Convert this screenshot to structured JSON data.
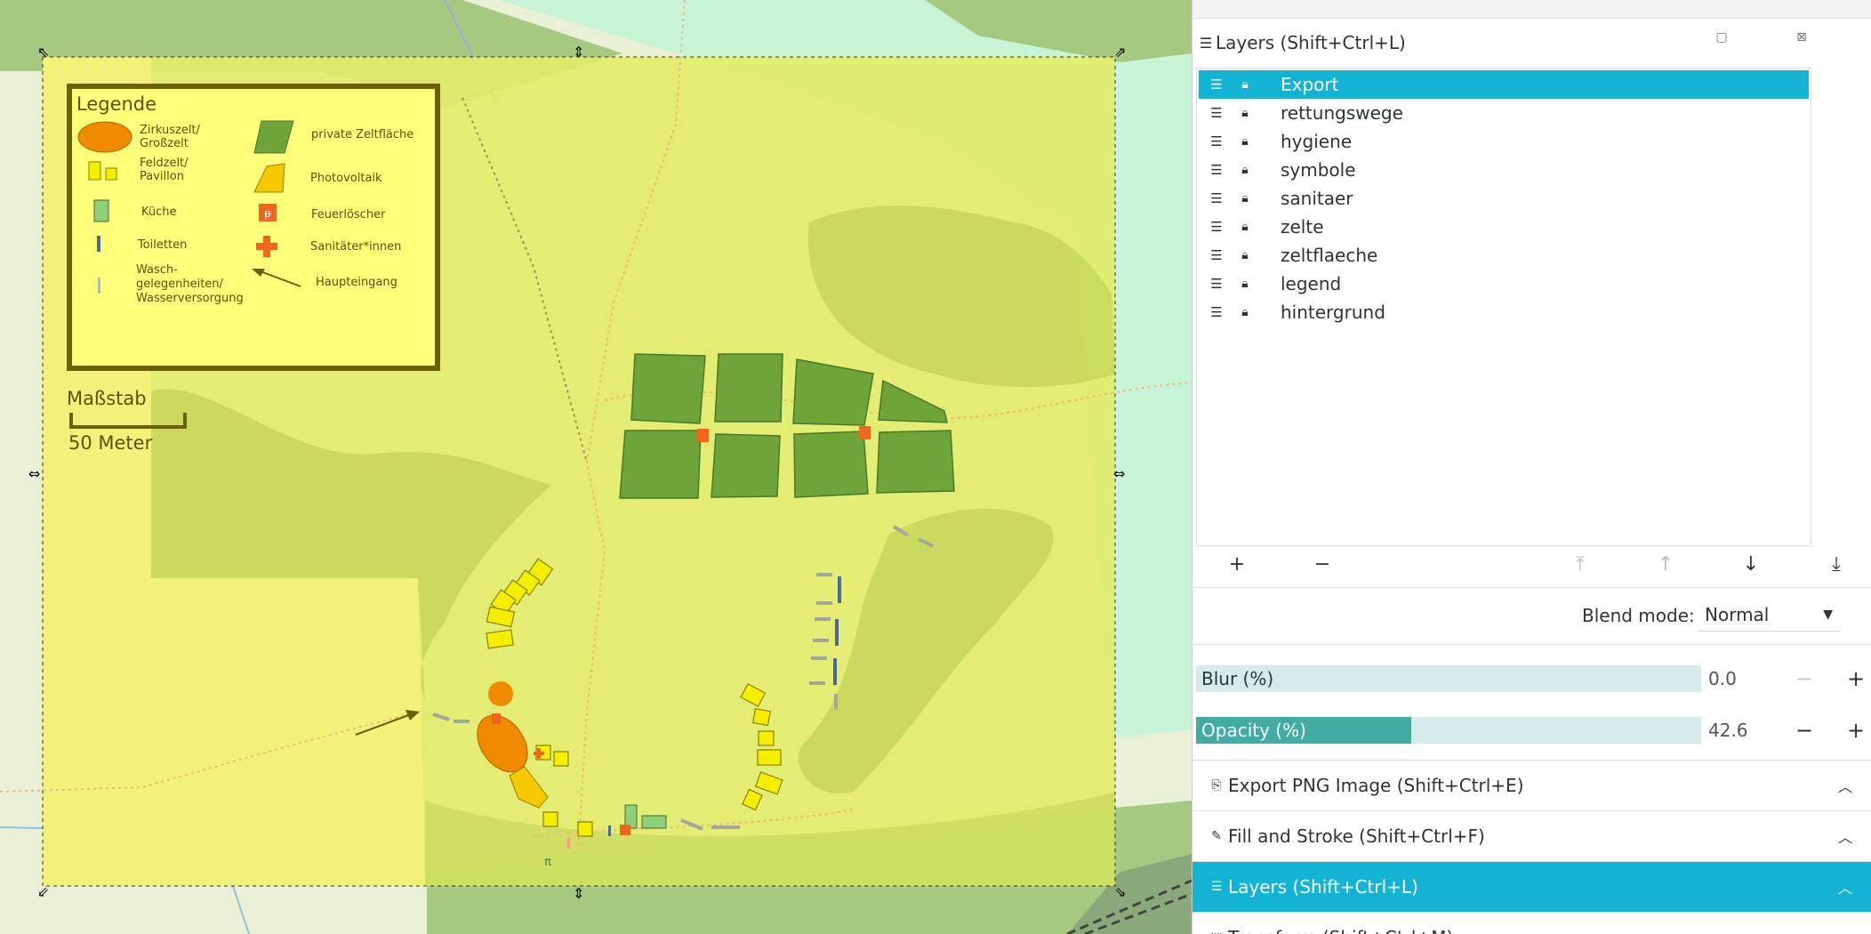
{
  "map": {
    "legend": {
      "title": "Legende",
      "items": {
        "zirkuszelt": "Zirkuszelt/\nGroßzelt",
        "feldzelt": "Feldzelt/\nPavillon",
        "kueche": "Küche",
        "toiletten": "Toiletten",
        "wasch": "Wasch-\ngelegenheiten/\nWasserversorgung",
        "zeltflaeche": "private Zeltfläche",
        "photovoltaik": "Photovoltaik",
        "feuerloescher": "Feuerlöscher",
        "sanitaeter": "Sanitäter*innen",
        "haupteingang": "Haupteingang"
      }
    },
    "scale": {
      "title": "Maßstab",
      "distance": "50 Meter"
    },
    "colors": {
      "page": "#dce85f",
      "legend_fill": "#ffff7a",
      "legend_border": "#6b6000",
      "zeltflaeche": "#6ea43a",
      "zirkuszelt": "#f08a00",
      "feldzelt": "#f6ee00",
      "kueche": "#8fcf78",
      "feuerloescher": "#f0661c",
      "forest": "#a9c97a"
    }
  },
  "panel": {
    "header": {
      "icon": "layers-icon",
      "title": "Layers (Shift+Ctrl+L)"
    },
    "layers": [
      {
        "name": "Export",
        "selected": true
      },
      {
        "name": "rettungswege",
        "selected": false
      },
      {
        "name": "hygiene",
        "selected": false
      },
      {
        "name": "symbole",
        "selected": false
      },
      {
        "name": "sanitaer",
        "selected": false
      },
      {
        "name": "zelte",
        "selected": false
      },
      {
        "name": "zeltflaeche",
        "selected": false
      },
      {
        "name": "legend",
        "selected": false
      },
      {
        "name": "hintergrund",
        "selected": false
      }
    ],
    "toolbar": {
      "add": "+",
      "remove": "−",
      "raise_top": "⤒",
      "raise": "↑",
      "lower": "↓",
      "lower_bottom": "⤓"
    },
    "blend": {
      "label": "Blend mode:",
      "value": "Normal"
    },
    "blur": {
      "label": "Blur (%)",
      "value": "0.0",
      "percent": 0
    },
    "opacity": {
      "label": "Opacity (%)",
      "value": "42.6",
      "percent": 42.6
    },
    "sections": {
      "export": "Export PNG Image (Shift+Ctrl+E)",
      "fill_stroke": "Fill and Stroke (Shift+Ctrl+F)",
      "layers": "Layers (Shift+Ctrl+L)",
      "transform": "Transform (Shift+Ctrl+M)"
    }
  }
}
